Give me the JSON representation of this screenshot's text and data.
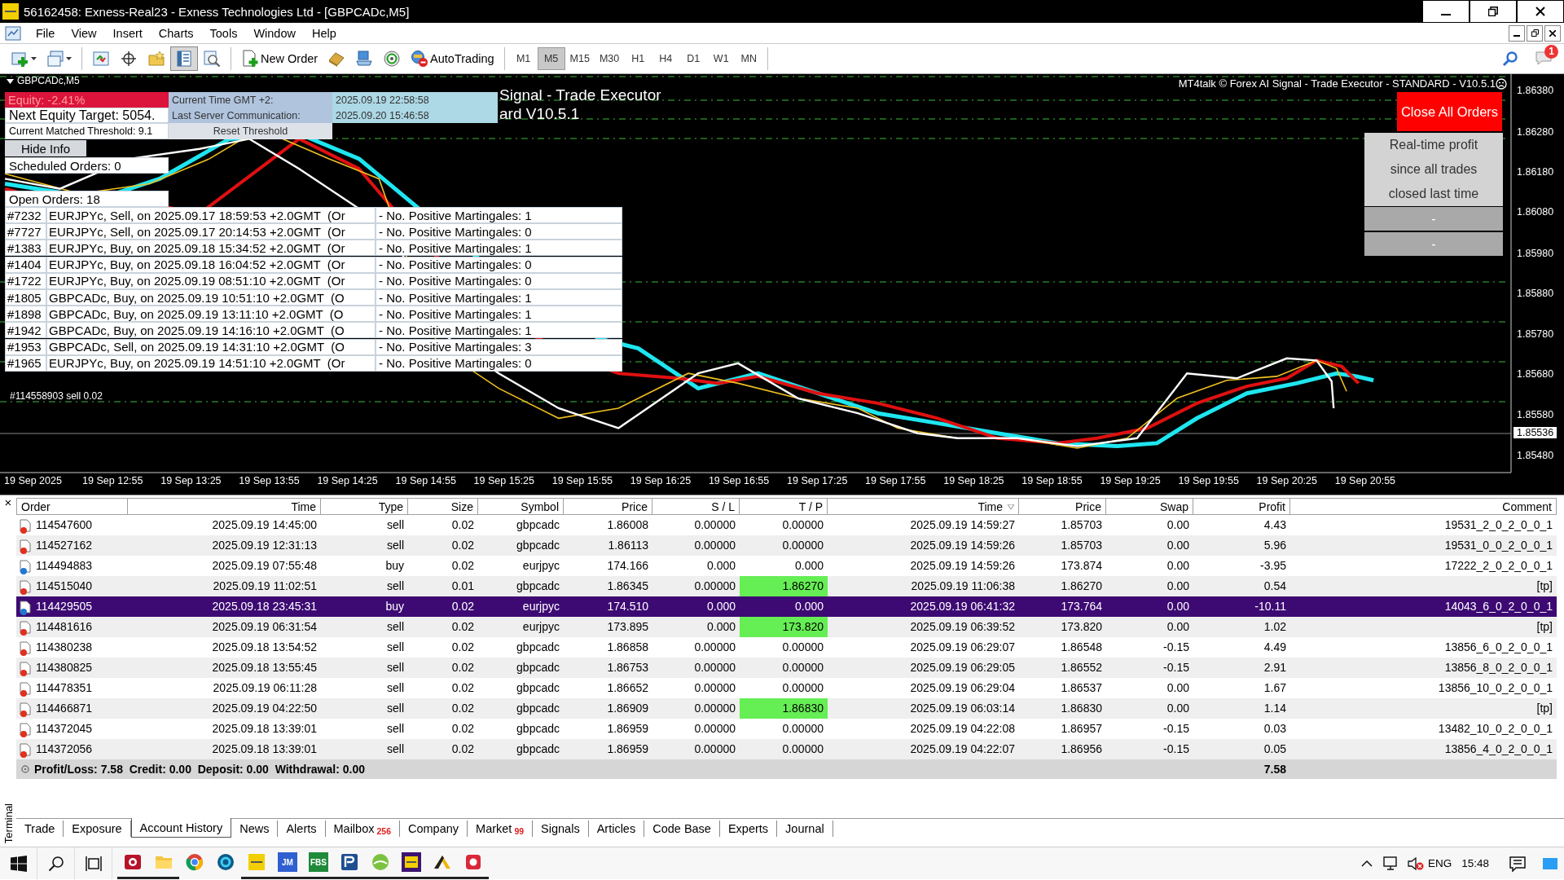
{
  "window": {
    "title": "56162458: Exness-Real23 - Exness Technologies Ltd - [GBPCADc,M5]"
  },
  "menu": [
    "File",
    "View",
    "Insert",
    "Charts",
    "Tools",
    "Window",
    "Help"
  ],
  "toolbar": {
    "tool_buttons": [
      {
        "pressed": false
      },
      {
        "pressed": false
      },
      {
        "pressed": false
      },
      {
        "pressed": true
      },
      {
        "pressed": false
      }
    ],
    "new_order": "New Order",
    "autotrading": "AutoTrading",
    "timeframes": [
      {
        "label": "M1",
        "selected": false
      },
      {
        "label": "M5",
        "selected": true
      },
      {
        "label": "M15",
        "selected": false
      },
      {
        "label": "M30",
        "selected": false
      },
      {
        "label": "H1",
        "selected": false
      },
      {
        "label": "H4",
        "selected": false
      },
      {
        "label": "D1",
        "selected": false
      },
      {
        "label": "W1",
        "selected": false
      },
      {
        "label": "MN",
        "selected": false
      }
    ],
    "notification_badge": "1"
  },
  "chart": {
    "symbol": "GBPCADc,M5",
    "watermark_lines": [
      "Signal - Trade Executor",
      "ard V10.5.1"
    ],
    "header": "MT4talk © Forex AI Signal - Trade Executor - STANDARD - V10.5.1",
    "info": {
      "equity": "Equity: -2.41%",
      "next_target": "Next Equity Target: 5054.",
      "threshold": "Current Matched Threshold: 9.1",
      "time_label": "Current Time GMT +2:",
      "time_value": "2025.09.19 22:58:58",
      "server_label": "Last Server Communication:",
      "server_value": "2025.09.20 15:46:58",
      "reset_button": "Reset Threshold",
      "hide_button": "Hide Info",
      "scheduled": "Scheduled Orders: 0",
      "open": "Open Orders: 18"
    },
    "open_orders": [
      {
        "id": "#7232",
        "desc": "EURJPYc, Sell, on 2025.09.17 18:59:53 +2.0GMT  (Or",
        "martingales": "- No. Positive Martingales: 1"
      },
      {
        "id": "#7727",
        "desc": "EURJPYc, Sell, on 2025.09.17 20:14:53 +2.0GMT  (Or",
        "martingales": "- No. Positive Martingales: 0"
      },
      {
        "id": "#1383",
        "desc": "EURJPYc, Buy, on 2025.09.18 15:34:52 +2.0GMT  (Or",
        "martingales": "- No. Positive Martingales: 1"
      },
      {
        "id": "#1404",
        "desc": "EURJPYc, Buy, on 2025.09.18 16:04:52 +2.0GMT  (Or",
        "martingales": "- No. Positive Martingales: 0"
      },
      {
        "id": "#1722",
        "desc": "EURJPYc, Buy, on 2025.09.19 08:51:10 +2.0GMT  (Or",
        "martingales": "- No. Positive Martingales: 0"
      },
      {
        "id": "#1805",
        "desc": "GBPCADc, Buy, on 2025.09.19 10:51:10 +2.0GMT  (O",
        "martingales": "- No. Positive Martingales: 1"
      },
      {
        "id": "#1898",
        "desc": "GBPCADc, Buy, on 2025.09.19 13:11:10 +2.0GMT  (O",
        "martingales": "- No. Positive Martingales: 1"
      },
      {
        "id": "#1942",
        "desc": "GBPCADc, Buy, on 2025.09.19 14:16:10 +2.0GMT  (O",
        "martingales": "- No. Positive Martingales: 1"
      },
      {
        "id": "#1953",
        "desc": "GBPCADc, Sell, on 2025.09.19 14:31:10 +2.0GMT  (O",
        "martingales": "- No. Positive Martingales: 3"
      },
      {
        "id": "#1965",
        "desc": "EURJPYc, Buy, on 2025.09.19 14:51:10 +2.0GMT  (Or",
        "martingales": "- No. Positive Martingales: 0"
      }
    ],
    "order_label": "#114558903 sell 0.02",
    "close_all_button": "Close All Orders",
    "profit_panel": {
      "lines": [
        "Real-time profit",
        "since all trades",
        "closed last time"
      ],
      "values": [
        "-",
        "-"
      ]
    },
    "price_axis": [
      "1.86380",
      "1.86280",
      "1.86180",
      "1.86080",
      "1.85980",
      "1.85880",
      "1.85780",
      "1.85680",
      "1.85580",
      "1.85480"
    ],
    "current_price": "1.85536",
    "time_axis": [
      "19 Sep 2025",
      "19 Sep 12:55",
      "19 Sep 13:25",
      "19 Sep 13:55",
      "19 Sep 14:25",
      "19 Sep 14:55",
      "19 Sep 15:25",
      "19 Sep 15:55",
      "19 Sep 16:25",
      "19 Sep 16:55",
      "19 Sep 17:25",
      "19 Sep 17:55",
      "19 Sep 18:25",
      "19 Sep 18:55",
      "19 Sep 19:25",
      "19 Sep 19:55",
      "19 Sep 20:25",
      "19 Sep 20:55"
    ]
  },
  "terminal": {
    "close": "×",
    "label": "Terminal",
    "columns": [
      "Order",
      "Time",
      "Type",
      "Size",
      "Symbol",
      "Price",
      "S / L",
      "T / P",
      "Time",
      "Price",
      "Swap",
      "Profit",
      "Comment"
    ],
    "rows": [
      {
        "cells": [
          "114547600",
          "2025.09.19 14:45:00",
          "sell",
          "0.02",
          "gbpcadc",
          "1.86008",
          "0.00000",
          "0.00000",
          "2025.09.19 14:59:27",
          "1.85703",
          "0.00",
          "4.43",
          "19531_2_0_2_0_0_1"
        ],
        "color": "#e0301e",
        "tp_highlight": false,
        "selected": false
      },
      {
        "cells": [
          "114527162",
          "2025.09.19 12:31:13",
          "sell",
          "0.02",
          "gbpcadc",
          "1.86113",
          "0.00000",
          "0.00000",
          "2025.09.19 14:59:26",
          "1.85703",
          "0.00",
          "5.96",
          "19531_0_0_2_0_0_1"
        ],
        "color": "#e0301e",
        "tp_highlight": false,
        "selected": false
      },
      {
        "cells": [
          "114494883",
          "2025.09.19 07:55:48",
          "buy",
          "0.02",
          "eurjpyc",
          "174.166",
          "0.000",
          "0.000",
          "2025.09.19 14:59:26",
          "173.874",
          "0.00",
          "-3.95",
          "17222_2_0_2_0_0_1"
        ],
        "color": "#1e78d7",
        "tp_highlight": false,
        "selected": false
      },
      {
        "cells": [
          "114515040",
          "2025.09.19 11:02:51",
          "sell",
          "0.01",
          "gbpcadc",
          "1.86345",
          "0.00000",
          "1.86270",
          "2025.09.19 11:06:38",
          "1.86270",
          "0.00",
          "0.54",
          "[tp]"
        ],
        "color": "#e0301e",
        "tp_highlight": true,
        "selected": false
      },
      {
        "cells": [
          "114429505",
          "2025.09.18 23:45:31",
          "buy",
          "0.02",
          "eurjpyc",
          "174.510",
          "0.000",
          "0.000",
          "2025.09.19 06:41:32",
          "173.764",
          "0.00",
          "-10.11",
          "14043_6_0_2_0_0_1"
        ],
        "color": "#1e78d7",
        "tp_highlight": false,
        "selected": true
      },
      {
        "cells": [
          "114481616",
          "2025.09.19 06:31:54",
          "sell",
          "0.02",
          "eurjpyc",
          "173.895",
          "0.000",
          "173.820",
          "2025.09.19 06:39:52",
          "173.820",
          "0.00",
          "1.02",
          "[tp]"
        ],
        "color": "#e0301e",
        "tp_highlight": true,
        "selected": false
      },
      {
        "cells": [
          "114380238",
          "2025.09.18 13:54:52",
          "sell",
          "0.02",
          "gbpcadc",
          "1.86858",
          "0.00000",
          "0.00000",
          "2025.09.19 06:29:07",
          "1.86548",
          "-0.15",
          "4.49",
          "13856_6_0_2_0_0_1"
        ],
        "color": "#e0301e",
        "tp_highlight": false,
        "selected": false
      },
      {
        "cells": [
          "114380825",
          "2025.09.18 13:55:45",
          "sell",
          "0.02",
          "gbpcadc",
          "1.86753",
          "0.00000",
          "0.00000",
          "2025.09.19 06:29:05",
          "1.86552",
          "-0.15",
          "2.91",
          "13856_8_0_2_0_0_1"
        ],
        "color": "#e0301e",
        "tp_highlight": false,
        "selected": false
      },
      {
        "cells": [
          "114478351",
          "2025.09.19 06:11:28",
          "sell",
          "0.02",
          "gbpcadc",
          "1.86652",
          "0.00000",
          "0.00000",
          "2025.09.19 06:29:04",
          "1.86537",
          "0.00",
          "1.67",
          "13856_10_0_2_0_0_1"
        ],
        "color": "#e0301e",
        "tp_highlight": false,
        "selected": false
      },
      {
        "cells": [
          "114466871",
          "2025.09.19 04:22:50",
          "sell",
          "0.02",
          "gbpcadc",
          "1.86909",
          "0.00000",
          "1.86830",
          "2025.09.19 06:03:14",
          "1.86830",
          "0.00",
          "1.14",
          "[tp]"
        ],
        "color": "#e0301e",
        "tp_highlight": true,
        "selected": false
      },
      {
        "cells": [
          "114372045",
          "2025.09.18 13:39:01",
          "sell",
          "0.02",
          "gbpcadc",
          "1.86959",
          "0.00000",
          "0.00000",
          "2025.09.19 04:22:08",
          "1.86957",
          "-0.15",
          "0.03",
          "13482_10_0_2_0_0_1"
        ],
        "color": "#e0301e",
        "tp_highlight": false,
        "selected": false
      },
      {
        "cells": [
          "114372056",
          "2025.09.18 13:39:01",
          "sell",
          "0.02",
          "gbpcadc",
          "1.86959",
          "0.00000",
          "0.00000",
          "2025.09.19 04:22:07",
          "1.86956",
          "-0.15",
          "0.05",
          "13856_4_0_2_0_0_1"
        ],
        "color": "#e0301e",
        "tp_highlight": false,
        "selected": false
      }
    ],
    "summary": "Profit/Loss: 7.58  Credit: 0.00  Deposit: 0.00  Withdrawal: 0.00",
    "summary_profit": "7.58",
    "tabs": [
      {
        "label": "Trade",
        "selected": false
      },
      {
        "label": "Exposure",
        "selected": false
      },
      {
        "label": "Account History",
        "selected": true
      },
      {
        "label": "News",
        "selected": false
      },
      {
        "label": "Alerts",
        "selected": false
      },
      {
        "label": "Mailbox",
        "badge": "256",
        "selected": false
      },
      {
        "label": "Company",
        "selected": false
      },
      {
        "label": "Market",
        "badge": "99",
        "selected": false
      },
      {
        "label": "Signals",
        "selected": false
      },
      {
        "label": "Articles",
        "selected": false
      },
      {
        "label": "Code Base",
        "selected": false
      },
      {
        "label": "Experts",
        "selected": false
      },
      {
        "label": "Journal",
        "selected": false
      }
    ]
  },
  "taskbar": {
    "apps": [
      {
        "running": true
      },
      {
        "running": true
      },
      {
        "running": false
      },
      {
        "running": false
      },
      {
        "running": true
      },
      {
        "running": true,
        "label": "JM"
      },
      {
        "running": true,
        "label": "FBS"
      },
      {
        "running": true
      },
      {
        "running": true
      },
      {
        "running": true
      },
      {
        "running": true
      },
      {
        "running": true
      }
    ],
    "language": "ENG",
    "clock": "15:48"
  }
}
